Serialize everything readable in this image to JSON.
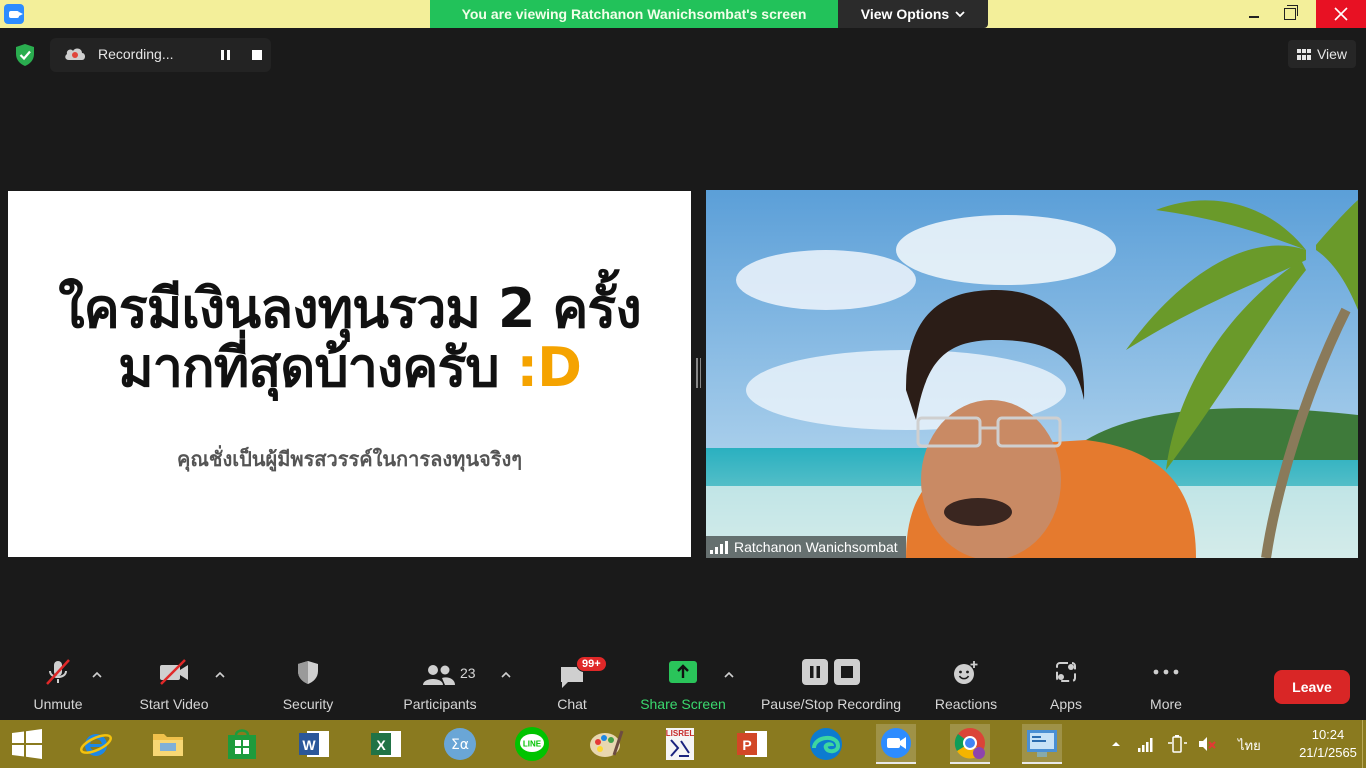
{
  "titlebar": {
    "banner_text": "You are viewing Ratchanon Wanichsombat's screen",
    "view_options_label": "View Options"
  },
  "recording": {
    "status_text": "Recording..."
  },
  "view_button": {
    "label": "View"
  },
  "slide": {
    "title_line1": "ใครมีเงินลงทุนรวม 2 ครั้ง",
    "title_line2": "มากที่สุดบ้างครับ ",
    "title_accent": ":D",
    "subtitle": "คุณชั่งเป็นผู้มีพรสวรรค์ในการลงทุนจริงๆ",
    "accent_color": "#f5a300"
  },
  "video": {
    "participant_name": "Ratchanon Wanichsombat"
  },
  "toolbar": {
    "unmute_label": "Unmute",
    "start_video_label": "Start Video",
    "security_label": "Security",
    "participants_label": "Participants",
    "participants_count": "23",
    "chat_label": "Chat",
    "chat_badge": "99+",
    "share_screen_label": "Share Screen",
    "pause_stop_label": "Pause/Stop Recording",
    "reactions_label": "Reactions",
    "apps_label": "Apps",
    "more_label": "More",
    "leave_label": "Leave"
  },
  "taskbar": {
    "apps": [
      "internet-explorer-icon",
      "file-explorer-icon",
      "store-icon",
      "word-icon",
      "excel-icon",
      "math-icon",
      "line-icon",
      "paint-icon",
      "lisrel-icon",
      "powerpoint-icon",
      "edge-icon",
      "zoom-icon",
      "chrome-icon",
      "control-panel-icon"
    ],
    "language": "ไทย",
    "time": "10:24",
    "date": "21/1/2565"
  },
  "colors": {
    "banner_green": "#22c25a",
    "titlebar_yellow": "#f3ef9a",
    "leave_red": "#d92626",
    "taskbar": "#8a7a1f"
  }
}
